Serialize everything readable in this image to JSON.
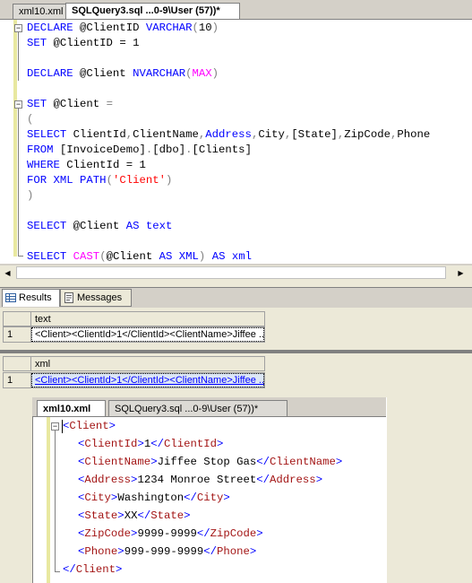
{
  "top_tabs": [
    {
      "label": "xml10.xml",
      "active": false
    },
    {
      "label": "SQLQuery3.sql ...0-9\\User (57))*",
      "active": true
    }
  ],
  "sql": {
    "l1": {
      "kw1": "DECLARE",
      "var": " @ClientID ",
      "type": "VARCHAR",
      "open": "(",
      "num": "10",
      "close": ")"
    },
    "l2": {
      "kw": "SET",
      "var": " @ClientID ",
      "eq": "= 1"
    },
    "l4": {
      "kw": "DECLARE",
      "var": " @Client ",
      "type": "NVARCHAR",
      "open": "(",
      "max": "MAX",
      "close": ")"
    },
    "l6": {
      "kw": "SET",
      "var": " @Client ",
      "eq": "="
    },
    "l7": "(",
    "l8": {
      "kw": "SELECT",
      "cols1": " ClientId",
      "c1": ",",
      "cols2": "ClientName",
      "c2": ",",
      "addr": "Address",
      "c3": ",",
      "cols3": "City",
      "c4": ",",
      "cols4": "[State]",
      "c5": ",",
      "cols5": "ZipCode",
      "c6": ",",
      "cols6": "Phone"
    },
    "l9": {
      "kw": "FROM",
      "obj": " [InvoiceDemo]",
      "d1": ".",
      "obj2": "[dbo]",
      "d2": ".",
      "obj3": "[Clients]"
    },
    "l10": {
      "kw": "WHERE",
      "rest": " ClientId ",
      "eq": "= 1"
    },
    "l11": {
      "kw": "FOR XML PATH",
      "open": "(",
      "str": "'Client'",
      "close": ")"
    },
    "l12": ")",
    "l14": {
      "kw": "SELECT",
      "var": " @Client ",
      "kw2": "AS",
      "alias": " text"
    },
    "l16": {
      "kw": "SELECT",
      "sp": " ",
      "fn": "CAST",
      "open": "(",
      "var": "@Client ",
      "kw2": "AS XML",
      "close": ")",
      "sp2": " ",
      "kw3": "AS",
      "alias": " xml"
    }
  },
  "results_tabs": [
    {
      "label": "Results",
      "icon": "grid-icon",
      "active": true
    },
    {
      "label": "Messages",
      "icon": "messages-icon",
      "active": false
    }
  ],
  "grid1": {
    "header": "text",
    "row_num": "1",
    "value": "<Client><ClientId>1</ClientId><ClientName>Jiffee ..."
  },
  "grid2": {
    "header": "xml",
    "row_num": "1",
    "value": "<Client><ClientId>1</ClientId><ClientName>Jiffee ..."
  },
  "xml_tabs": [
    {
      "label": "xml10.xml",
      "active": true
    },
    {
      "label": "SQLQuery3.sql ...0-9\\User (57))*",
      "active": false
    }
  ],
  "xml": {
    "root_open": "Client",
    "fields": [
      {
        "tag": "ClientId",
        "value": "1"
      },
      {
        "tag": "ClientName",
        "value": "Jiffee Stop Gas"
      },
      {
        "tag": "Address",
        "value": "1234 Monroe Street"
      },
      {
        "tag": "City",
        "value": "Washington"
      },
      {
        "tag": "State",
        "value": "XX"
      },
      {
        "tag": "ZipCode",
        "value": "9999-9999"
      },
      {
        "tag": "Phone",
        "value": "999-999-9999"
      }
    ],
    "root_close": "Client"
  },
  "colors": {
    "keyword": "#0000ff",
    "function": "#ff00ff",
    "string": "#ff0000",
    "tag": "#a31515"
  }
}
